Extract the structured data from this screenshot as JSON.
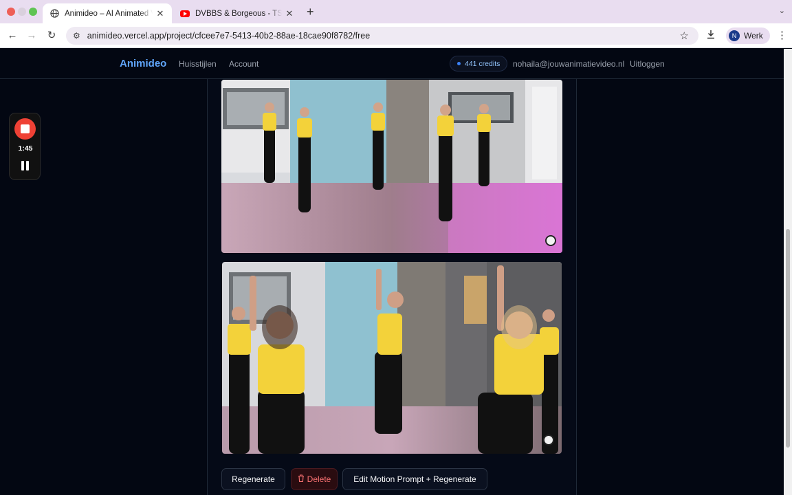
{
  "browser": {
    "tabs": [
      {
        "title": "Animideo – AI Animated Video",
        "active": true,
        "favicon": "globe-icon"
      },
      {
        "title": "DVBBS & Borgeous - TSUNAMI",
        "active": false,
        "favicon": "youtube-icon"
      }
    ],
    "url": "animideo.vercel.app/project/cfcee7e7-5413-40b2-88ae-18cae90f8782/free",
    "profile_initial": "N",
    "profile_name": "Werk"
  },
  "site": {
    "brand": "Animideo",
    "nav": {
      "styles": "Huisstijlen",
      "account": "Account"
    },
    "credits": "441 credits",
    "email": "nohaila@jouwanimatievideo.nl",
    "logout": "Uitloggen",
    "accent_color": "#60a5fa"
  },
  "actions": {
    "regenerate": "Regenerate",
    "delete": "Delete",
    "edit_motion": "Edit Motion Prompt + Regenerate"
  },
  "recorder": {
    "elapsed": "1:45"
  }
}
